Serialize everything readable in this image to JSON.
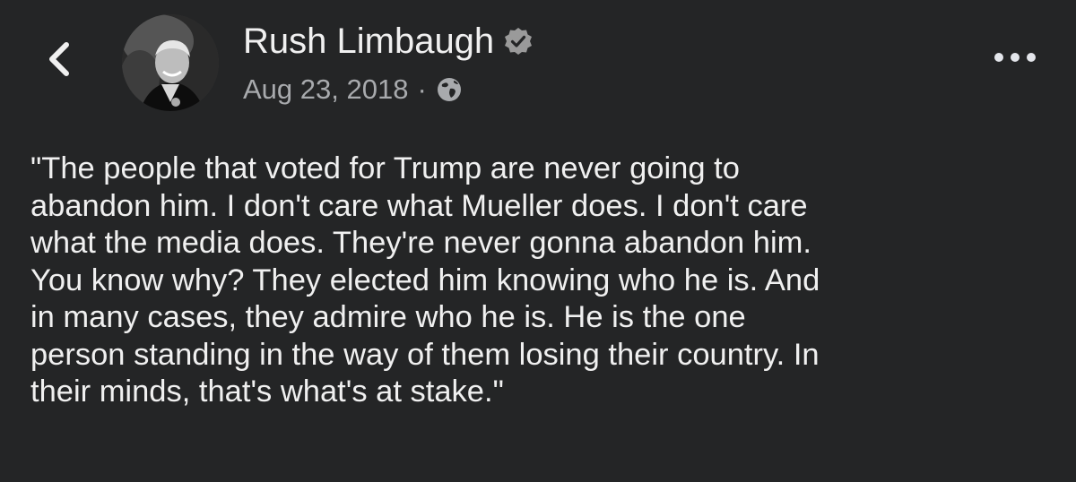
{
  "header": {
    "back_icon": "chevron-left-icon",
    "author_name": "Rush Limbaugh",
    "verified_icon": "verified-badge-icon",
    "date": "Aug 23, 2018",
    "separator": "·",
    "audience_icon": "globe-icon",
    "more_icon": "more-horizontal-icon"
  },
  "post": {
    "text": "\"The people that voted for Trump are never going to\nabandon him.  I don't care what Mueller does.  I don't care\nwhat the media does.  They're never gonna abandon him.\nYou know why?  They elected him knowing who he is.  And\nin many cases, they admire who he is.  He is the one\nperson standing in the way of them losing their country.  In\ntheir minds, that's what's at stake.\""
  },
  "colors": {
    "background": "#242526",
    "primary_text": "#f0f0f0",
    "secondary_text": "#a8aaad"
  }
}
